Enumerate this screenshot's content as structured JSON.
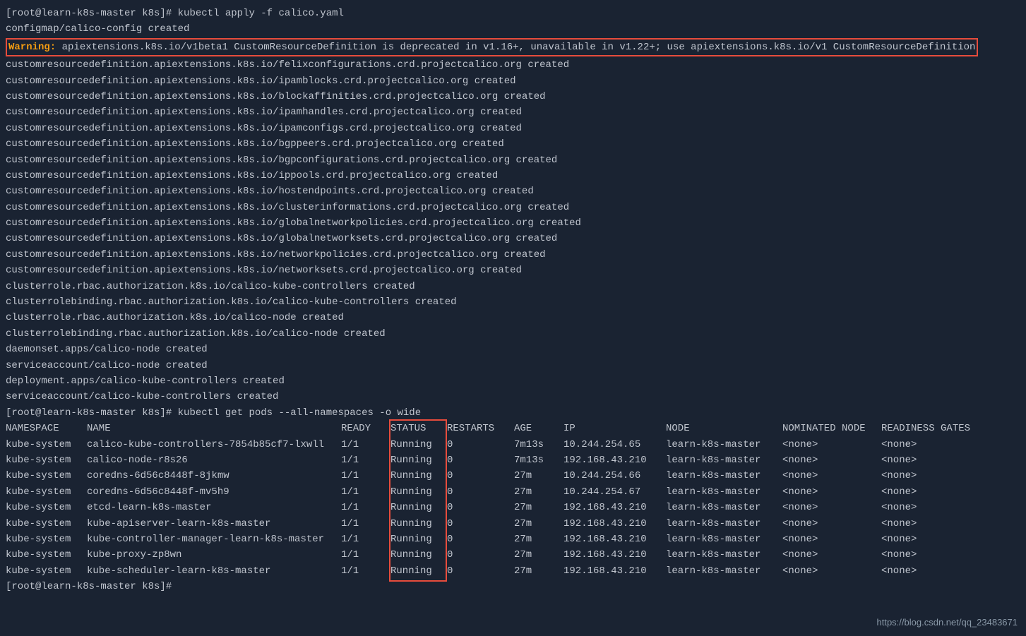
{
  "prompt1": {
    "user_host": "[root@learn-k8s-master k8s]#",
    "cmd": "kubectl apply -f calico.yaml"
  },
  "output_lines": [
    "configmap/calico-config created"
  ],
  "warning": {
    "label": "Warning:",
    "text": " apiextensions.k8s.io/v1beta1 CustomResourceDefinition is deprecated in v1.16+, unavailable in v1.22+; use apiextensions.k8s.io/v1 CustomResourceDefinition"
  },
  "crd_lines": [
    "customresourcedefinition.apiextensions.k8s.io/felixconfigurations.crd.projectcalico.org created",
    "customresourcedefinition.apiextensions.k8s.io/ipamblocks.crd.projectcalico.org created",
    "customresourcedefinition.apiextensions.k8s.io/blockaffinities.crd.projectcalico.org created",
    "customresourcedefinition.apiextensions.k8s.io/ipamhandles.crd.projectcalico.org created",
    "customresourcedefinition.apiextensions.k8s.io/ipamconfigs.crd.projectcalico.org created",
    "customresourcedefinition.apiextensions.k8s.io/bgppeers.crd.projectcalico.org created",
    "customresourcedefinition.apiextensions.k8s.io/bgpconfigurations.crd.projectcalico.org created",
    "customresourcedefinition.apiextensions.k8s.io/ippools.crd.projectcalico.org created",
    "customresourcedefinition.apiextensions.k8s.io/hostendpoints.crd.projectcalico.org created",
    "customresourcedefinition.apiextensions.k8s.io/clusterinformations.crd.projectcalico.org created",
    "customresourcedefinition.apiextensions.k8s.io/globalnetworkpolicies.crd.projectcalico.org created",
    "customresourcedefinition.apiextensions.k8s.io/globalnetworksets.crd.projectcalico.org created",
    "customresourcedefinition.apiextensions.k8s.io/networkpolicies.crd.projectcalico.org created",
    "customresourcedefinition.apiextensions.k8s.io/networksets.crd.projectcalico.org created",
    "clusterrole.rbac.authorization.k8s.io/calico-kube-controllers created",
    "clusterrolebinding.rbac.authorization.k8s.io/calico-kube-controllers created",
    "clusterrole.rbac.authorization.k8s.io/calico-node created",
    "clusterrolebinding.rbac.authorization.k8s.io/calico-node created",
    "daemonset.apps/calico-node created",
    "serviceaccount/calico-node created",
    "deployment.apps/calico-kube-controllers created",
    "serviceaccount/calico-kube-controllers created"
  ],
  "prompt2": {
    "user_host": "[root@learn-k8s-master k8s]#",
    "cmd": "kubectl get pods --all-namespaces -o wide"
  },
  "pods": {
    "headers": {
      "ns": "NAMESPACE",
      "name": "NAME",
      "ready": "READY",
      "status": "STATUS",
      "restarts": "RESTARTS",
      "age": "AGE",
      "ip": "IP",
      "node": "NODE",
      "nominated": "NOMINATED NODE",
      "readiness": "READINESS GATES"
    },
    "rows": [
      {
        "ns": "kube-system",
        "name": "calico-kube-controllers-7854b85cf7-lxwll",
        "ready": "1/1",
        "status": "Running",
        "restarts": "0",
        "age": "7m13s",
        "ip": "10.244.254.65",
        "node": "learn-k8s-master",
        "nom": "<none>",
        "read": "<none>"
      },
      {
        "ns": "kube-system",
        "name": "calico-node-r8s26",
        "ready": "1/1",
        "status": "Running",
        "restarts": "0",
        "age": "7m13s",
        "ip": "192.168.43.210",
        "node": "learn-k8s-master",
        "nom": "<none>",
        "read": "<none>"
      },
      {
        "ns": "kube-system",
        "name": "coredns-6d56c8448f-8jkmw",
        "ready": "1/1",
        "status": "Running",
        "restarts": "0",
        "age": "27m",
        "ip": "10.244.254.66",
        "node": "learn-k8s-master",
        "nom": "<none>",
        "read": "<none>"
      },
      {
        "ns": "kube-system",
        "name": "coredns-6d56c8448f-mv5h9",
        "ready": "1/1",
        "status": "Running",
        "restarts": "0",
        "age": "27m",
        "ip": "10.244.254.67",
        "node": "learn-k8s-master",
        "nom": "<none>",
        "read": "<none>"
      },
      {
        "ns": "kube-system",
        "name": "etcd-learn-k8s-master",
        "ready": "1/1",
        "status": "Running",
        "restarts": "0",
        "age": "27m",
        "ip": "192.168.43.210",
        "node": "learn-k8s-master",
        "nom": "<none>",
        "read": "<none>"
      },
      {
        "ns": "kube-system",
        "name": "kube-apiserver-learn-k8s-master",
        "ready": "1/1",
        "status": "Running",
        "restarts": "0",
        "age": "27m",
        "ip": "192.168.43.210",
        "node": "learn-k8s-master",
        "nom": "<none>",
        "read": "<none>"
      },
      {
        "ns": "kube-system",
        "name": "kube-controller-manager-learn-k8s-master",
        "ready": "1/1",
        "status": "Running",
        "restarts": "0",
        "age": "27m",
        "ip": "192.168.43.210",
        "node": "learn-k8s-master",
        "nom": "<none>",
        "read": "<none>"
      },
      {
        "ns": "kube-system",
        "name": "kube-proxy-zp8wn",
        "ready": "1/1",
        "status": "Running",
        "restarts": "0",
        "age": "27m",
        "ip": "192.168.43.210",
        "node": "learn-k8s-master",
        "nom": "<none>",
        "read": "<none>"
      },
      {
        "ns": "kube-system",
        "name": "kube-scheduler-learn-k8s-master",
        "ready": "1/1",
        "status": "Running",
        "restarts": "0",
        "age": "27m",
        "ip": "192.168.43.210",
        "node": "learn-k8s-master",
        "nom": "<none>",
        "read": "<none>"
      }
    ]
  },
  "prompt3": {
    "user_host": "[root@learn-k8s-master k8s]#",
    "cmd": ""
  },
  "watermark": "https://blog.csdn.net/qq_23483671"
}
